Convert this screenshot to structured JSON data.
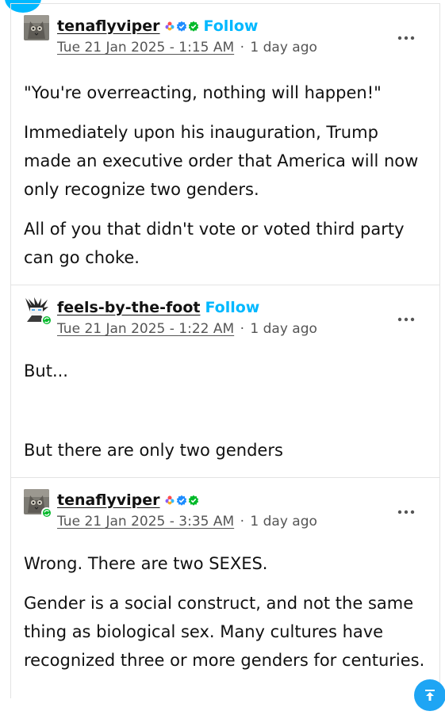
{
  "posts": [
    {
      "username": "tenaflyviper",
      "follow_label": "Follow",
      "timestamp": "Tue 21 Jan 2025 - 1:15 AM",
      "separator": "·",
      "relative_time": "1 day ago",
      "paragraphs": [
        "\"You're overreacting, nothing will happen!\"",
        "Immediately upon his inauguration, Trump made an executive order that America will now only recognize two genders.",
        "All of you that didn't vote or voted third party can go choke."
      ]
    },
    {
      "username": "feels-by-the-foot",
      "follow_label": "Follow",
      "timestamp": "Tue 21 Jan 2025 - 1:22 AM",
      "separator": "·",
      "relative_time": "1 day ago",
      "paragraphs": [
        "But...",
        "But there are only two genders"
      ]
    },
    {
      "username": "tenaflyviper",
      "timestamp": "Tue 21 Jan 2025 - 3:35 AM",
      "separator": "·",
      "relative_time": "1 day ago",
      "paragraphs": [
        "Wrong.  There are two SEXES.",
        "Gender is a social construct, and not the same thing as biological sex.  Many cultures have recognized three or more genders for centuries."
      ]
    }
  ],
  "icons": {
    "more": "more-options-icon",
    "scroll_top": "scroll-to-top-icon",
    "close": "close-icon",
    "status": "refresh-status-icon",
    "badges": [
      "rainbow-flower-badge",
      "blue-verified-badge",
      "green-check-badge"
    ]
  },
  "colors": {
    "follow": "#00b8ff",
    "fab": "#1ea5f4",
    "status": "#00b929"
  }
}
